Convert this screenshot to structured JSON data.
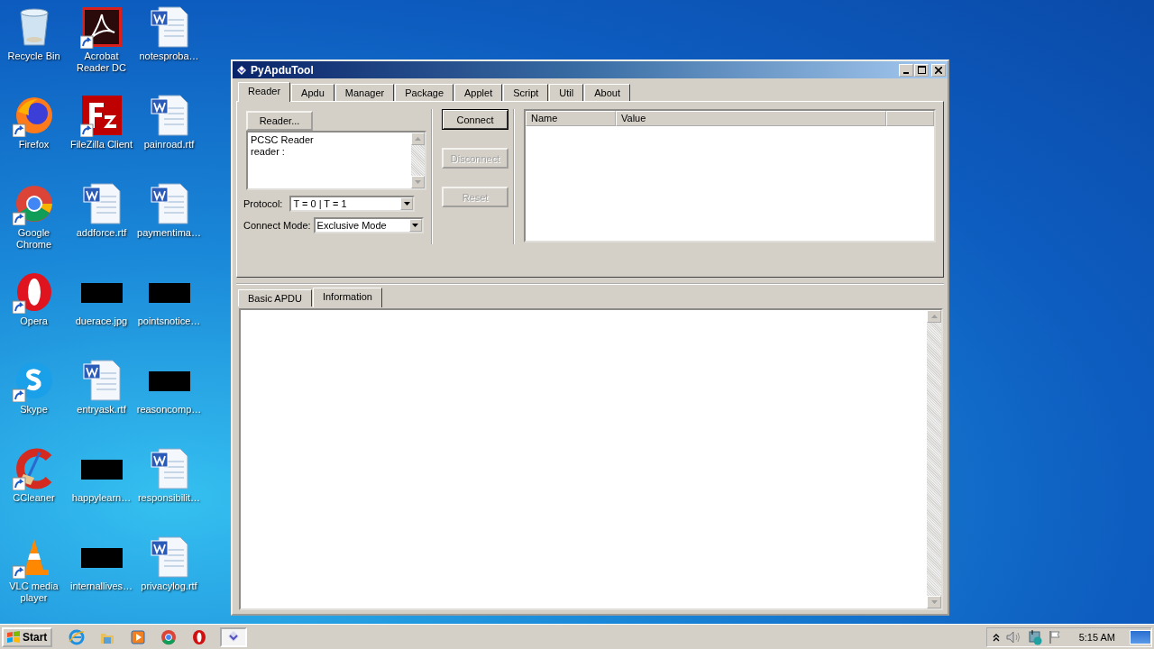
{
  "desktop": {
    "icons": [
      {
        "label": "Recycle Bin",
        "kind": "recycle",
        "shortcut": false
      },
      {
        "label": "Firefox",
        "kind": "firefox",
        "shortcut": true
      },
      {
        "label": "Google Chrome",
        "kind": "chrome",
        "shortcut": true
      },
      {
        "label": "Opera",
        "kind": "opera",
        "shortcut": true
      },
      {
        "label": "Skype",
        "kind": "skype",
        "shortcut": true
      },
      {
        "label": "CCleaner",
        "kind": "ccleaner",
        "shortcut": true
      },
      {
        "label": "VLC media player",
        "kind": "vlc",
        "shortcut": true
      },
      {
        "label": "Acrobat Reader DC",
        "kind": "acrobat",
        "shortcut": true
      },
      {
        "label": "FileZilla Client",
        "kind": "filezilla",
        "shortcut": true
      },
      {
        "label": "addforce.rtf",
        "kind": "word",
        "shortcut": false
      },
      {
        "label": "duerace.jpg",
        "kind": "image",
        "shortcut": false
      },
      {
        "label": "entryask.rtf",
        "kind": "word",
        "shortcut": false
      },
      {
        "label": "happylearn…",
        "kind": "image",
        "shortcut": false
      },
      {
        "label": "internallives…",
        "kind": "image",
        "shortcut": false
      },
      {
        "label": "notesproba…",
        "kind": "word",
        "shortcut": false
      },
      {
        "label": "painroad.rtf",
        "kind": "word",
        "shortcut": false
      },
      {
        "label": "paymentima…",
        "kind": "word",
        "shortcut": false
      },
      {
        "label": "pointsnotice…",
        "kind": "image",
        "shortcut": false
      },
      {
        "label": "reasoncomp…",
        "kind": "image",
        "shortcut": false
      },
      {
        "label": "responsibilit…",
        "kind": "word",
        "shortcut": false
      },
      {
        "label": "privacylog.rtf",
        "kind": "word",
        "shortcut": false
      }
    ]
  },
  "window": {
    "title": "PyApduTool",
    "tabs": [
      {
        "label": "Reader",
        "selected": true
      },
      {
        "label": "Apdu",
        "selected": false
      },
      {
        "label": "Manager",
        "selected": false
      },
      {
        "label": "Package",
        "selected": false
      },
      {
        "label": "Applet",
        "selected": false
      },
      {
        "label": "Script",
        "selected": false
      },
      {
        "label": "Util",
        "selected": false
      },
      {
        "label": "About",
        "selected": false
      }
    ],
    "reader_button": "Reader...",
    "reader_list": [
      "PCSC Reader",
      "reader :"
    ],
    "protocol": {
      "label": "Protocol:",
      "value": "T = 0 | T = 1"
    },
    "connect_mode": {
      "label": "Connect Mode:",
      "value": "Exclusive Mode"
    },
    "buttons": [
      {
        "label": "Connect",
        "disabled": false
      },
      {
        "label": "Disconnect",
        "disabled": true
      },
      {
        "label": "Reset",
        "disabled": true
      }
    ],
    "table": {
      "columns": [
        "Name",
        "Value"
      ]
    },
    "bottom_tabs": [
      {
        "label": "Basic APDU",
        "selected": false
      },
      {
        "label": "Information",
        "selected": true
      }
    ]
  },
  "taskbar": {
    "start": "Start",
    "apps": [
      {
        "kind": "ie",
        "active": false
      },
      {
        "kind": "folder",
        "active": false
      },
      {
        "kind": "media",
        "active": false
      },
      {
        "kind": "chrome",
        "active": false
      },
      {
        "kind": "opera",
        "active": false
      },
      {
        "kind": "pyapdu",
        "active": true
      }
    ],
    "clock": "5:15 AM"
  }
}
